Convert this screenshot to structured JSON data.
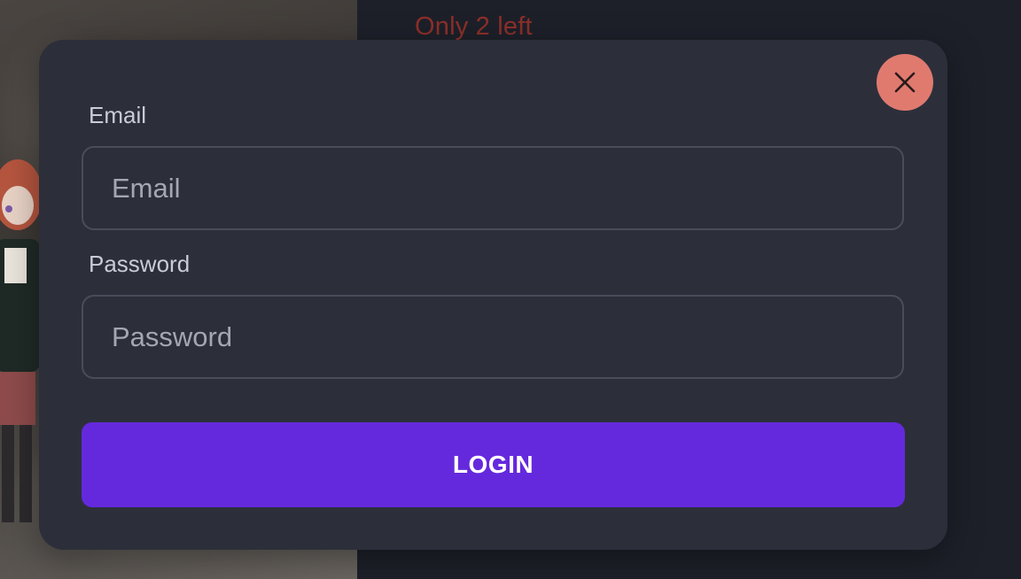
{
  "background": {
    "stock_notice": "Only 2 left",
    "stock_notice_color": "#8e2f2a"
  },
  "modal": {
    "close_icon": "close-icon",
    "email": {
      "label": "Email",
      "placeholder": "Email",
      "value": ""
    },
    "password": {
      "label": "Password",
      "placeholder": "Password",
      "value": ""
    },
    "login_label": "LOGIN"
  },
  "colors": {
    "modal_bg": "#2c2f3a",
    "accent": "#6529dd",
    "close_button": "#e07a6f"
  }
}
